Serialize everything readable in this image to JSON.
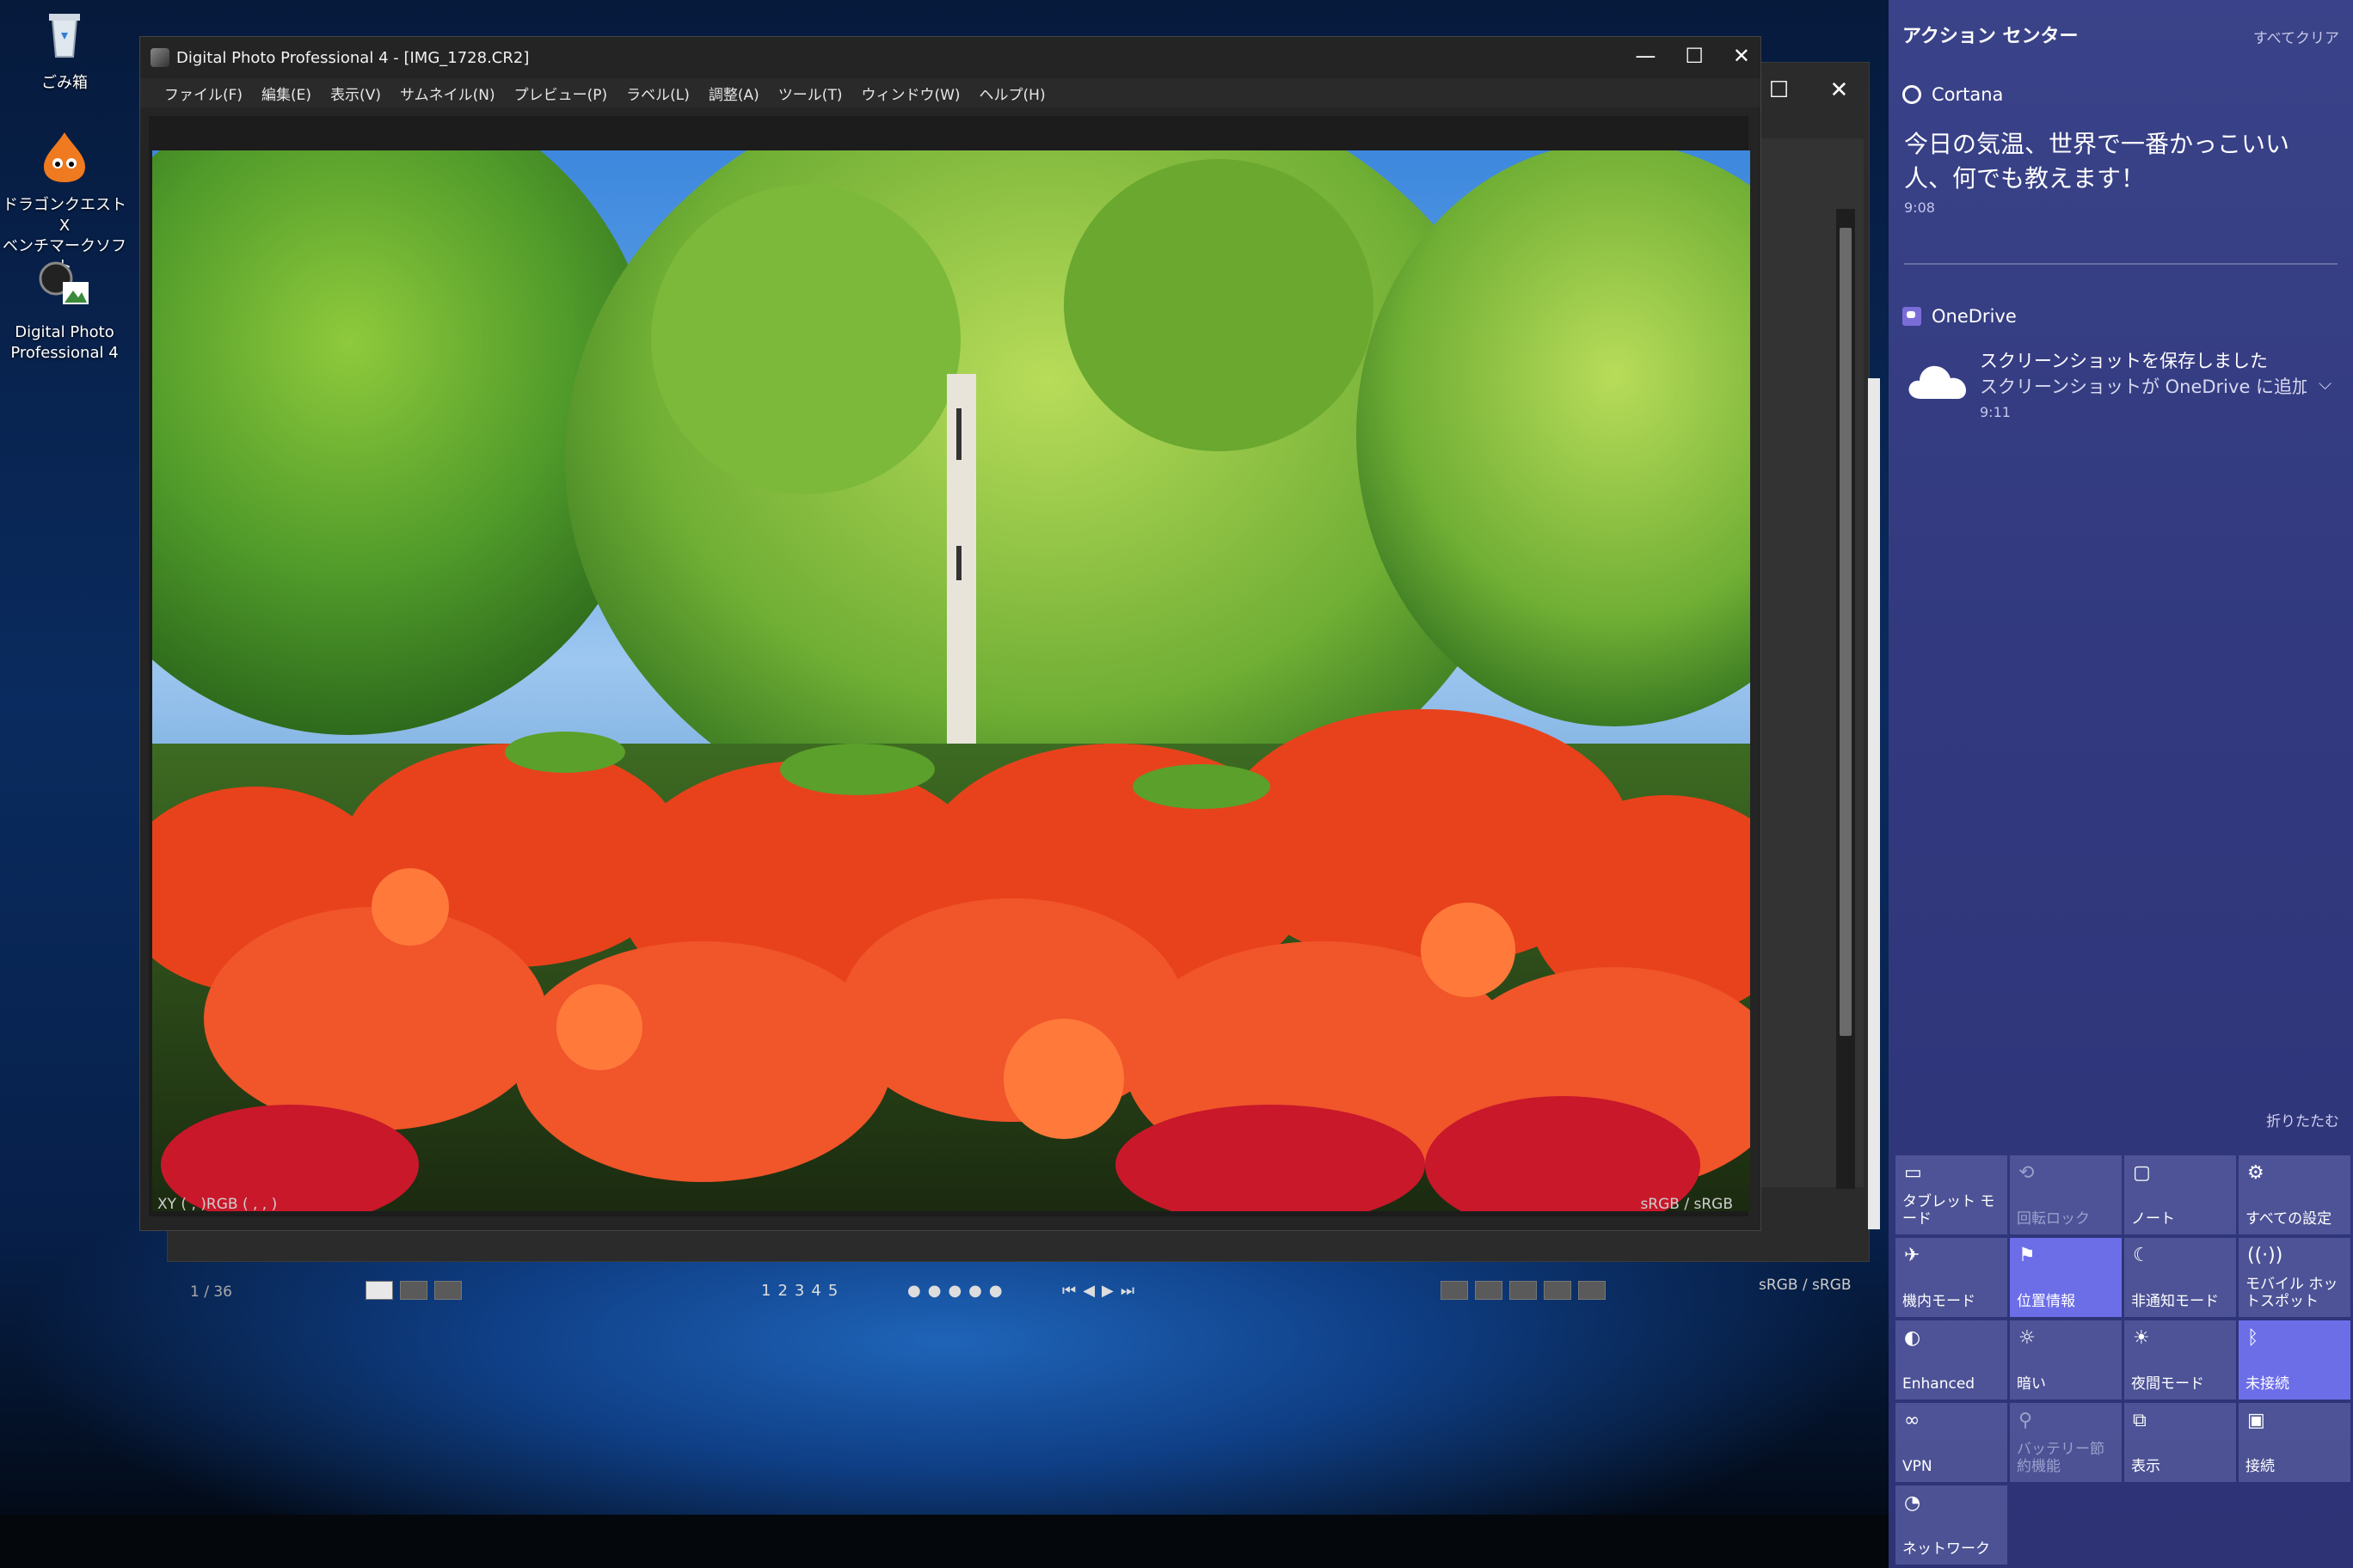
{
  "desktop": {
    "icons": [
      {
        "label": "ごみ箱"
      },
      {
        "label": "ドラゴンクエストX\nベンチマークソフト"
      },
      {
        "label": "Digital Photo\nProfessional 4"
      }
    ]
  },
  "background_window": {
    "count": "1 / 36",
    "status_right": "sRGB / sRGB",
    "page_numbers": [
      "1",
      "2",
      "3",
      "4",
      "5"
    ]
  },
  "dpp_window": {
    "title": "Digital Photo Professional 4 - [IMG_1728.CR2]",
    "menu": [
      "ファイル(F)",
      "編集(E)",
      "表示(V)",
      "サムネイル(N)",
      "プレビュー(P)",
      "ラベル(L)",
      "調整(A)",
      "ツール(T)",
      "ウィンドウ(W)",
      "ヘルプ(H)"
    ],
    "status_left": "XY (     ,     )RGB (     ,     ,     )",
    "status_right": "sRGB / sRGB"
  },
  "action_center": {
    "title": "アクション センター",
    "clear_all": "すべてクリア",
    "cortana": {
      "app": "Cortana",
      "message": "今日の気温、世界で一番かっこいい人、何でも教えます！",
      "time": "9:08"
    },
    "onedrive": {
      "app": "OneDrive",
      "title": "スクリーンショットを保存しました",
      "body": "スクリーンショットが OneDrive に追加されま",
      "time": "9:11"
    },
    "collapse": "折りたたむ",
    "tiles": [
      {
        "label": "タブレット モード",
        "icon": "tablet-mode-icon",
        "state": "off"
      },
      {
        "label": "回転ロック",
        "icon": "rotation-lock-icon",
        "state": "disabled"
      },
      {
        "label": "ノート",
        "icon": "note-icon",
        "state": "off"
      },
      {
        "label": "すべての設定",
        "icon": "settings-icon",
        "state": "off"
      },
      {
        "label": "機内モード",
        "icon": "airplane-icon",
        "state": "off"
      },
      {
        "label": "位置情報",
        "icon": "location-icon",
        "state": "on"
      },
      {
        "label": "非通知モード",
        "icon": "quiet-hours-icon",
        "state": "off"
      },
      {
        "label": "モバイル ホットスポット",
        "icon": "hotspot-icon",
        "state": "off"
      },
      {
        "label": "Enhanced",
        "icon": "color-icon",
        "state": "off"
      },
      {
        "label": "暗い",
        "icon": "brightness-icon",
        "state": "off"
      },
      {
        "label": "夜間モード",
        "icon": "night-light-icon",
        "state": "off"
      },
      {
        "label": "未接続",
        "icon": "bluetooth-icon",
        "state": "on"
      },
      {
        "label": "VPN",
        "icon": "vpn-icon",
        "state": "off"
      },
      {
        "label": "バッテリー節約機能",
        "icon": "battery-saver-icon",
        "state": "disabled"
      },
      {
        "label": "表示",
        "icon": "project-icon",
        "state": "off"
      },
      {
        "label": "接続",
        "icon": "connect-icon",
        "state": "off"
      },
      {
        "label": "ネットワーク",
        "icon": "network-icon",
        "state": "off"
      }
    ]
  }
}
